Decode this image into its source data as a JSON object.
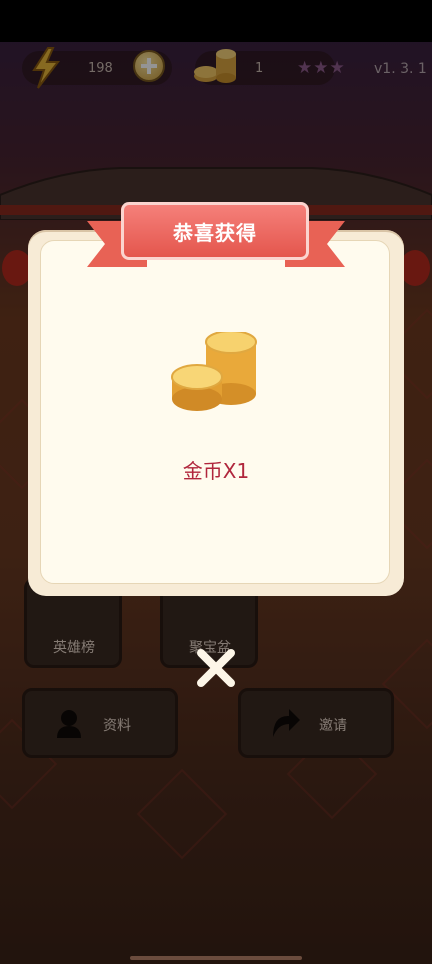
{
  "hud": {
    "energy_value": "198",
    "coin_value": "1",
    "stars": "★★★",
    "version": "v1. 3. 1",
    "energy_icon": "lightning-icon",
    "add_icon": "plus-icon",
    "coin_icon": "coin-stack-icon"
  },
  "menu": {
    "heroes_label": "英雄榜",
    "treasure_label": "聚宝盆",
    "profile_label": "资料",
    "invite_label": "邀请"
  },
  "dialog": {
    "title": "恭喜获得",
    "reward_label": "金币X1",
    "reward_icon": "gold-coins-icon",
    "close_icon": "close-icon"
  },
  "colors": {
    "ribbon": "#e86255",
    "reward_text": "#b0263c",
    "dialog_bg": "#fffbee"
  }
}
